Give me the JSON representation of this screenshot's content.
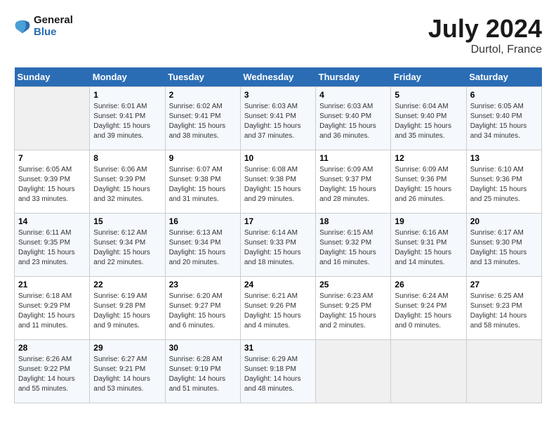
{
  "header": {
    "logo_line1": "General",
    "logo_line2": "Blue",
    "month": "July 2024",
    "location": "Durtol, France"
  },
  "days_of_week": [
    "Sunday",
    "Monday",
    "Tuesday",
    "Wednesday",
    "Thursday",
    "Friday",
    "Saturday"
  ],
  "weeks": [
    [
      {
        "day": "",
        "sunrise": "",
        "sunset": "",
        "daylight": ""
      },
      {
        "day": "1",
        "sunrise": "Sunrise: 6:01 AM",
        "sunset": "Sunset: 9:41 PM",
        "daylight": "Daylight: 15 hours and 39 minutes."
      },
      {
        "day": "2",
        "sunrise": "Sunrise: 6:02 AM",
        "sunset": "Sunset: 9:41 PM",
        "daylight": "Daylight: 15 hours and 38 minutes."
      },
      {
        "day": "3",
        "sunrise": "Sunrise: 6:03 AM",
        "sunset": "Sunset: 9:41 PM",
        "daylight": "Daylight: 15 hours and 37 minutes."
      },
      {
        "day": "4",
        "sunrise": "Sunrise: 6:03 AM",
        "sunset": "Sunset: 9:40 PM",
        "daylight": "Daylight: 15 hours and 36 minutes."
      },
      {
        "day": "5",
        "sunrise": "Sunrise: 6:04 AM",
        "sunset": "Sunset: 9:40 PM",
        "daylight": "Daylight: 15 hours and 35 minutes."
      },
      {
        "day": "6",
        "sunrise": "Sunrise: 6:05 AM",
        "sunset": "Sunset: 9:40 PM",
        "daylight": "Daylight: 15 hours and 34 minutes."
      }
    ],
    [
      {
        "day": "7",
        "sunrise": "Sunrise: 6:05 AM",
        "sunset": "Sunset: 9:39 PM",
        "daylight": "Daylight: 15 hours and 33 minutes."
      },
      {
        "day": "8",
        "sunrise": "Sunrise: 6:06 AM",
        "sunset": "Sunset: 9:39 PM",
        "daylight": "Daylight: 15 hours and 32 minutes."
      },
      {
        "day": "9",
        "sunrise": "Sunrise: 6:07 AM",
        "sunset": "Sunset: 9:38 PM",
        "daylight": "Daylight: 15 hours and 31 minutes."
      },
      {
        "day": "10",
        "sunrise": "Sunrise: 6:08 AM",
        "sunset": "Sunset: 9:38 PM",
        "daylight": "Daylight: 15 hours and 29 minutes."
      },
      {
        "day": "11",
        "sunrise": "Sunrise: 6:09 AM",
        "sunset": "Sunset: 9:37 PM",
        "daylight": "Daylight: 15 hours and 28 minutes."
      },
      {
        "day": "12",
        "sunrise": "Sunrise: 6:09 AM",
        "sunset": "Sunset: 9:36 PM",
        "daylight": "Daylight: 15 hours and 26 minutes."
      },
      {
        "day": "13",
        "sunrise": "Sunrise: 6:10 AM",
        "sunset": "Sunset: 9:36 PM",
        "daylight": "Daylight: 15 hours and 25 minutes."
      }
    ],
    [
      {
        "day": "14",
        "sunrise": "Sunrise: 6:11 AM",
        "sunset": "Sunset: 9:35 PM",
        "daylight": "Daylight: 15 hours and 23 minutes."
      },
      {
        "day": "15",
        "sunrise": "Sunrise: 6:12 AM",
        "sunset": "Sunset: 9:34 PM",
        "daylight": "Daylight: 15 hours and 22 minutes."
      },
      {
        "day": "16",
        "sunrise": "Sunrise: 6:13 AM",
        "sunset": "Sunset: 9:34 PM",
        "daylight": "Daylight: 15 hours and 20 minutes."
      },
      {
        "day": "17",
        "sunrise": "Sunrise: 6:14 AM",
        "sunset": "Sunset: 9:33 PM",
        "daylight": "Daylight: 15 hours and 18 minutes."
      },
      {
        "day": "18",
        "sunrise": "Sunrise: 6:15 AM",
        "sunset": "Sunset: 9:32 PM",
        "daylight": "Daylight: 15 hours and 16 minutes."
      },
      {
        "day": "19",
        "sunrise": "Sunrise: 6:16 AM",
        "sunset": "Sunset: 9:31 PM",
        "daylight": "Daylight: 15 hours and 14 minutes."
      },
      {
        "day": "20",
        "sunrise": "Sunrise: 6:17 AM",
        "sunset": "Sunset: 9:30 PM",
        "daylight": "Daylight: 15 hours and 13 minutes."
      }
    ],
    [
      {
        "day": "21",
        "sunrise": "Sunrise: 6:18 AM",
        "sunset": "Sunset: 9:29 PM",
        "daylight": "Daylight: 15 hours and 11 minutes."
      },
      {
        "day": "22",
        "sunrise": "Sunrise: 6:19 AM",
        "sunset": "Sunset: 9:28 PM",
        "daylight": "Daylight: 15 hours and 9 minutes."
      },
      {
        "day": "23",
        "sunrise": "Sunrise: 6:20 AM",
        "sunset": "Sunset: 9:27 PM",
        "daylight": "Daylight: 15 hours and 6 minutes."
      },
      {
        "day": "24",
        "sunrise": "Sunrise: 6:21 AM",
        "sunset": "Sunset: 9:26 PM",
        "daylight": "Daylight: 15 hours and 4 minutes."
      },
      {
        "day": "25",
        "sunrise": "Sunrise: 6:23 AM",
        "sunset": "Sunset: 9:25 PM",
        "daylight": "Daylight: 15 hours and 2 minutes."
      },
      {
        "day": "26",
        "sunrise": "Sunrise: 6:24 AM",
        "sunset": "Sunset: 9:24 PM",
        "daylight": "Daylight: 15 hours and 0 minutes."
      },
      {
        "day": "27",
        "sunrise": "Sunrise: 6:25 AM",
        "sunset": "Sunset: 9:23 PM",
        "daylight": "Daylight: 14 hours and 58 minutes."
      }
    ],
    [
      {
        "day": "28",
        "sunrise": "Sunrise: 6:26 AM",
        "sunset": "Sunset: 9:22 PM",
        "daylight": "Daylight: 14 hours and 55 minutes."
      },
      {
        "day": "29",
        "sunrise": "Sunrise: 6:27 AM",
        "sunset": "Sunset: 9:21 PM",
        "daylight": "Daylight: 14 hours and 53 minutes."
      },
      {
        "day": "30",
        "sunrise": "Sunrise: 6:28 AM",
        "sunset": "Sunset: 9:19 PM",
        "daylight": "Daylight: 14 hours and 51 minutes."
      },
      {
        "day": "31",
        "sunrise": "Sunrise: 6:29 AM",
        "sunset": "Sunset: 9:18 PM",
        "daylight": "Daylight: 14 hours and 48 minutes."
      },
      {
        "day": "",
        "sunrise": "",
        "sunset": "",
        "daylight": ""
      },
      {
        "day": "",
        "sunrise": "",
        "sunset": "",
        "daylight": ""
      },
      {
        "day": "",
        "sunrise": "",
        "sunset": "",
        "daylight": ""
      }
    ]
  ]
}
